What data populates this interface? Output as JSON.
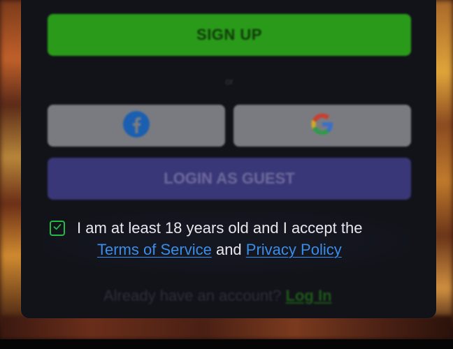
{
  "signup": {
    "label": "SIGN UP"
  },
  "divider": {
    "label": "or"
  },
  "social": {
    "facebook_icon": "facebook-icon",
    "google_icon": "google-icon"
  },
  "guest": {
    "label": "LOGIN AS GUEST"
  },
  "terms": {
    "checked": true,
    "text": "I am at least 18 years old and I accept the",
    "tos_link": "Terms of Service",
    "and": "and",
    "privacy_link": "Privacy Policy"
  },
  "footer": {
    "prompt": "Already have an account?",
    "login_link": "Log In"
  },
  "colors": {
    "signup": "#2a9a1a",
    "guest": "#3a3778",
    "link": "#3a8de8",
    "checkbox": "#27b84a"
  }
}
